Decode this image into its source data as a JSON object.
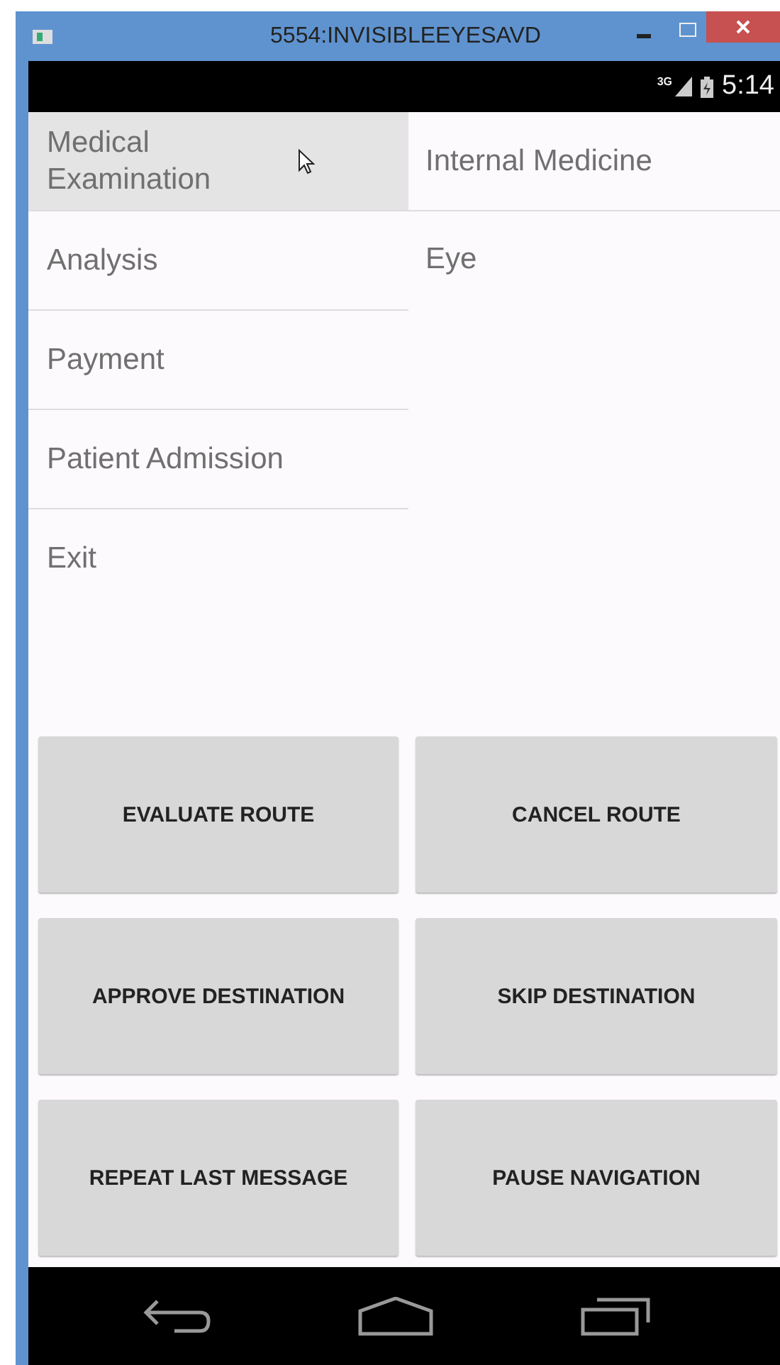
{
  "window": {
    "title": "5554:INVISIBLEEYESAVD"
  },
  "status_bar": {
    "time": "5:14",
    "network": "3G"
  },
  "menu": {
    "items": [
      {
        "label": "Medical Examination",
        "selected": true
      },
      {
        "label": "Analysis",
        "selected": false
      },
      {
        "label": "Payment",
        "selected": false
      },
      {
        "label": "Patient Admission",
        "selected": false
      },
      {
        "label": "Exit",
        "selected": false
      }
    ]
  },
  "submenu": {
    "items": [
      "Internal Medicine",
      "Eye"
    ]
  },
  "buttons": [
    "EVALUATE ROUTE",
    "CANCEL ROUTE",
    "APPROVE DESTINATION",
    "SKIP DESTINATION",
    "REPEAT LAST MESSAGE",
    "PAUSE NAVIGATION"
  ]
}
